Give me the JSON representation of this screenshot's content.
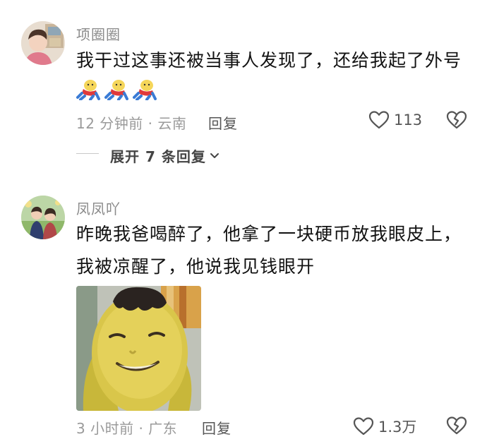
{
  "comments": [
    {
      "username": "项圈圈",
      "text_lines": [
        "我干过这事还被当事人发现了，还给我起了外号"
      ],
      "emojis": [
        "running-doll-emoji",
        "running-doll-emoji",
        "running-doll-emoji"
      ],
      "time": "12 分钟前",
      "location": "云南",
      "reply_label": "回复",
      "like_count": "113",
      "expand_label": "展开 7 条回复"
    },
    {
      "username": "凤凤吖",
      "text_lines": [
        "昨晚我爸喝醉了，他拿了一块硬币放我眼皮上，",
        "我被凉醒了，他说我见钱眼开"
      ],
      "time": "3 小时前",
      "location": "广东",
      "reply_label": "回复",
      "like_count": "1.3万"
    }
  ],
  "meta_separator": "·",
  "icons": {
    "like": "heart-outline-icon",
    "dislike": "broken-heart-icon",
    "expand": "chevron-down-icon"
  }
}
